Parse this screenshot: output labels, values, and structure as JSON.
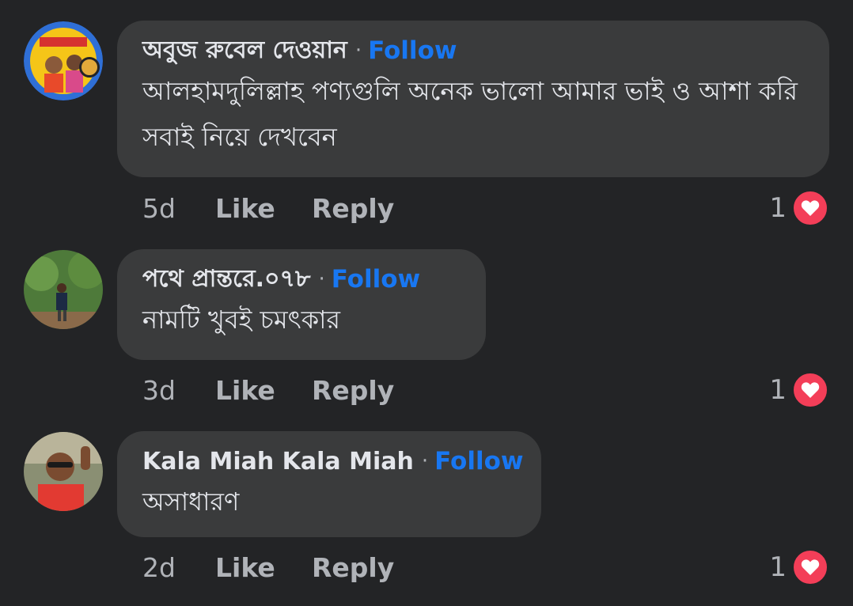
{
  "comments": [
    {
      "author": "অবুজ রুবেল দেওয়ান",
      "separator": "·",
      "follow_label": "Follow",
      "text": "আলহামদুলিল্লাহ পণ্যগুলি অনেক ভালো আমার ভাই ও আশা করি সবাই নিয়ে দেখবেন",
      "time": "5d",
      "like_label": "Like",
      "reply_label": "Reply",
      "reaction_count": "1",
      "reaction_icon": "heart-icon",
      "verified_badge": true
    },
    {
      "author": "পথে প্রান্তরে.০৭৮",
      "separator": "·",
      "follow_label": "Follow",
      "text": "নামটি খুবই চমৎকার",
      "time": "3d",
      "like_label": "Like",
      "reply_label": "Reply",
      "reaction_count": "1",
      "reaction_icon": "heart-icon"
    },
    {
      "author": "Kala Miah Kala Miah",
      "separator": "·",
      "follow_label": "Follow",
      "text": "অসাধারণ",
      "time": "2d",
      "like_label": "Like",
      "reply_label": "Reply",
      "reaction_count": "1",
      "reaction_icon": "heart-icon"
    }
  ],
  "colors": {
    "background": "#232426",
    "bubble": "#3a3b3c",
    "text": "#e4e6eb",
    "muted": "#b0b3b8",
    "follow": "#1877f2",
    "heart": "#f33e58"
  }
}
